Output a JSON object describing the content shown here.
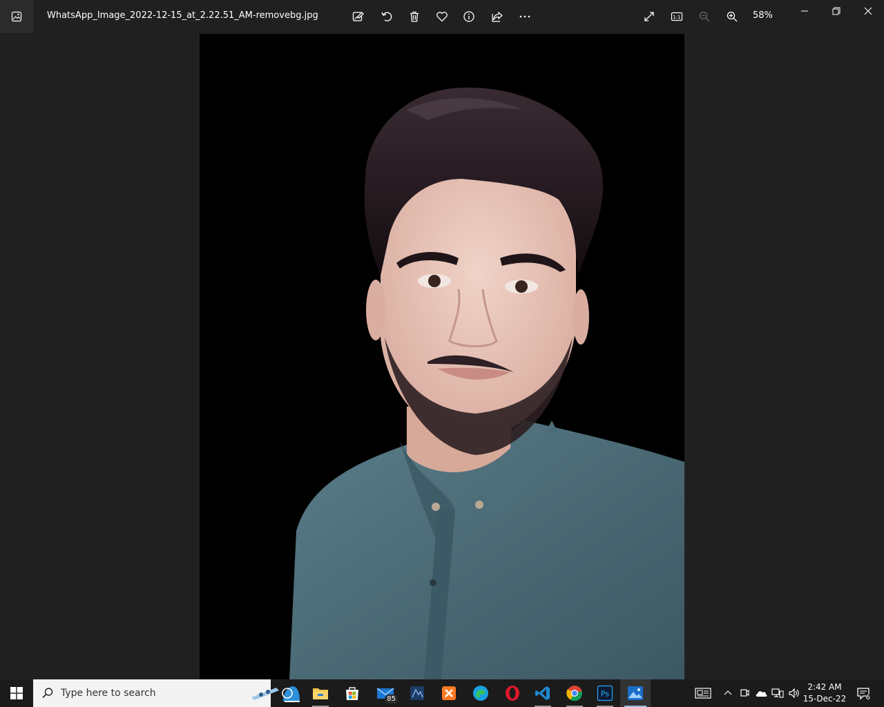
{
  "window": {
    "file_name": "WhatsApp_Image_2022-12-15_at_2.22.51_AM-removebg.jpg",
    "zoom_label": "58%",
    "toolbar_icons": [
      "edit-image-icon",
      "rotate-icon",
      "delete-icon",
      "favorite-icon",
      "info-icon",
      "share-icon",
      "more-icon"
    ],
    "view_icons": [
      "fullscreen-icon",
      "actual-size-icon",
      "zoom-out-icon",
      "zoom-in-icon"
    ]
  },
  "photo": {
    "description_colors": {
      "background": "#000000",
      "shirt": "#4e6f7b",
      "skin": "#e7c4b8",
      "hair": "#1c1417"
    }
  },
  "taskbar": {
    "search_placeholder": "Type here to search",
    "mail_badge": "85",
    "apps": [
      "file-explorer-icon",
      "microsoft-store-icon",
      "mail-icon",
      "app-icon",
      "xampp-icon",
      "edge-icon",
      "opera-icon",
      "vscode-icon",
      "chrome-icon",
      "photoshop-icon",
      "photos-icon"
    ],
    "photoshop_label": "Ps",
    "clock_time": "2:42 AM",
    "clock_date": "15-Dec-22",
    "notification_count": "6"
  }
}
